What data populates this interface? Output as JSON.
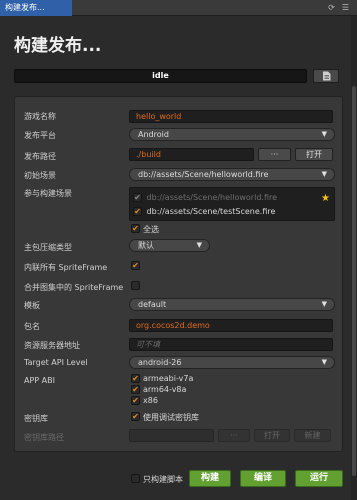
{
  "window": {
    "tab_title": "构建发布...",
    "ctrl_icons": [
      "refresh-icon",
      "menu-icon"
    ]
  },
  "page_title": "构建发布...",
  "status": {
    "text": "idle"
  },
  "fields": {
    "game_name": {
      "label": "游戏名称",
      "value": "hello_world"
    },
    "platform": {
      "label": "发布平台",
      "value": "Android"
    },
    "build_path": {
      "label": "发布路径",
      "value": "./build",
      "browse": "···",
      "open": "打开"
    },
    "start_scene": {
      "label": "初始场景",
      "value": "db://assets/Scene/helloworld.fire"
    },
    "scenes": {
      "label": "参与构建场景",
      "items": [
        {
          "path": "db://assets/Scene/helloworld.fire",
          "checked": true,
          "disabled": true,
          "starred": true
        },
        {
          "path": "db://assets/Scene/testScene.fire",
          "checked": true,
          "disabled": false,
          "starred": false
        }
      ],
      "select_all": "全选"
    },
    "compression": {
      "label": "主包压缩类型",
      "value": "默认"
    },
    "inline_spriteframe": {
      "label": "内联所有 SpriteFrame",
      "checked": true
    },
    "merge_spriteframe": {
      "label": "合并图集中的 SpriteFrame",
      "checked": false
    },
    "template": {
      "label": "模板",
      "value": "default"
    },
    "package_name": {
      "label": "包名",
      "value": "org.cocos2d.demo"
    },
    "resource_server": {
      "label": "资源服务器地址",
      "placeholder": "可不填"
    },
    "target_api": {
      "label": "Target API Level",
      "value": "android-26"
    },
    "app_abi": {
      "label": "APP ABI",
      "options": [
        {
          "name": "armeabi-v7a",
          "checked": true
        },
        {
          "name": "arm64-v8a",
          "checked": true
        },
        {
          "name": "x86",
          "checked": true
        }
      ]
    },
    "keystore": {
      "label": "密钥库",
      "option": "使用调试密钥库",
      "checked": true
    },
    "keystore_path": {
      "label": "密钥库路径",
      "browse": "···",
      "open": "打开",
      "new": "新建"
    }
  },
  "footer": {
    "build_script_only": "只构建脚本",
    "build": "构建",
    "compile": "编译",
    "run": "运行"
  },
  "colors": {
    "accent_orange": "#e06d1f",
    "tab_blue": "#2f60a8",
    "button_green": "#61a031",
    "star_yellow": "#f0c419"
  }
}
